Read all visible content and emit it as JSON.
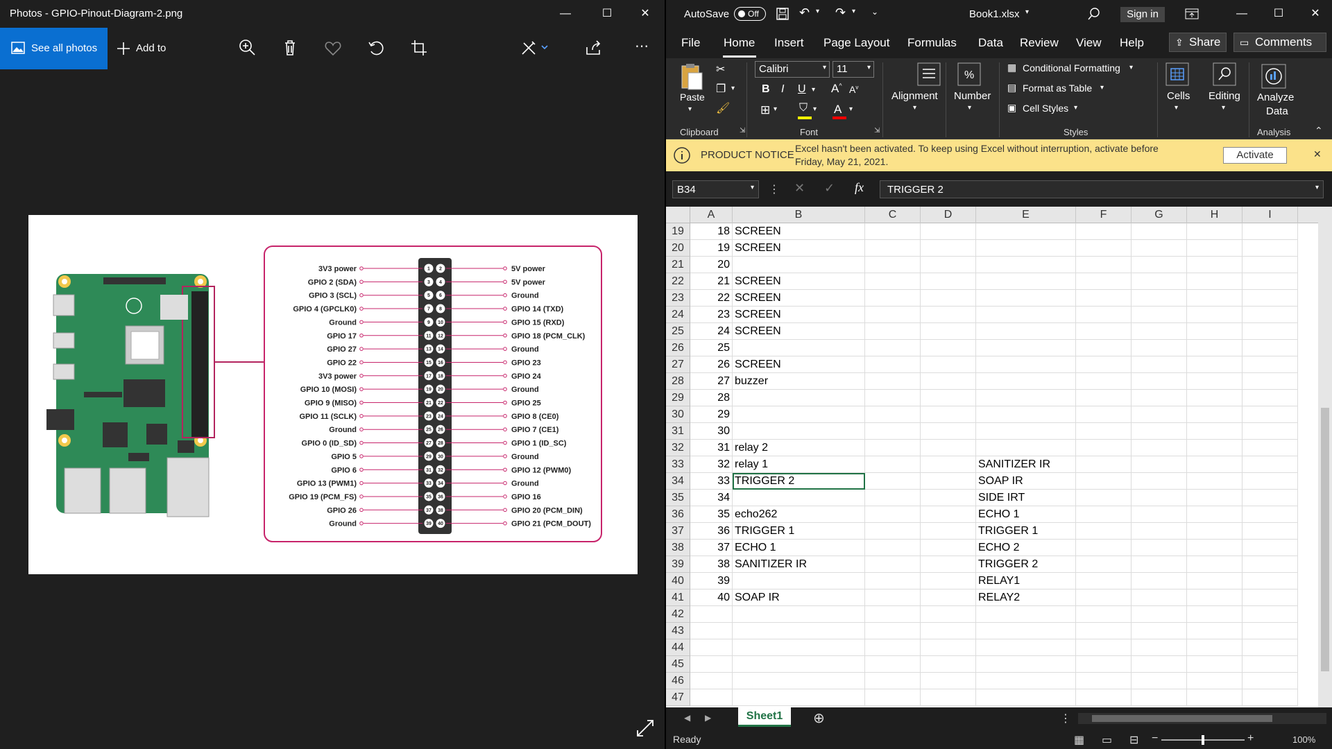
{
  "photos": {
    "title": "Photos - GPIO-Pinout-Diagram-2.png",
    "see_all": "See all photos",
    "add_to": "Add to",
    "left_pins": [
      "3V3 power",
      "GPIO 2 (SDA)",
      "GPIO 3 (SCL)",
      "GPIO 4 (GPCLK0)",
      "Ground",
      "GPIO 17",
      "GPIO 27",
      "GPIO 22",
      "3V3 power",
      "GPIO 10 (MOSI)",
      "GPIO 9 (MISO)",
      "GPIO 11 (SCLK)",
      "Ground",
      "GPIO 0 (ID_SD)",
      "GPIO 5",
      "GPIO 6",
      "GPIO 13 (PWM1)",
      "GPIO 19 (PCM_FS)",
      "GPIO 26",
      "Ground"
    ],
    "right_pins": [
      "5V power",
      "5V power",
      "Ground",
      "GPIO 14 (TXD)",
      "GPIO 15 (RXD)",
      "GPIO 18 (PCM_CLK)",
      "Ground",
      "GPIO 23",
      "GPIO 24",
      "Ground",
      "GPIO 25",
      "GPIO 8 (CE0)",
      "GPIO 7 (CE1)",
      "GPIO 1 (ID_SC)",
      "Ground",
      "GPIO 12 (PWM0)",
      "Ground",
      "GPIO 16",
      "GPIO 20 (PCM_DIN)",
      "GPIO 21 (PCM_DOUT)"
    ]
  },
  "excel": {
    "autosave": "AutoSave",
    "autosave_state": "Off",
    "filename": "Book1.xlsx",
    "signin": "Sign in",
    "tabs": [
      "File",
      "Home",
      "Insert",
      "Page Layout",
      "Formulas",
      "Data",
      "Review",
      "View",
      "Help"
    ],
    "share": "Share",
    "comments": "Comments",
    "ribbon": {
      "paste": "Paste",
      "font_name": "Calibri",
      "font_size": "11",
      "alignment": "Alignment",
      "number": "Number",
      "cond_format": "Conditional Formatting",
      "format_table": "Format as Table",
      "cell_styles": "Cell Styles",
      "cells": "Cells",
      "editing": "Editing",
      "analyze": "Analyze",
      "analyze2": "Data",
      "g_clipboard": "Clipboard",
      "g_font": "Font",
      "g_styles": "Styles",
      "g_analysis": "Analysis"
    },
    "notice": {
      "title": "PRODUCT NOTICE",
      "text1": "Excel hasn't been activated. To keep using Excel without interruption, activate before",
      "text2": "Friday, May 21, 2021.",
      "button": "Activate"
    },
    "name_box": "B34",
    "formula": "TRIGGER 2",
    "columns": [
      "A",
      "B",
      "C",
      "D",
      "E",
      "F",
      "G",
      "H",
      "I"
    ],
    "rows": [
      {
        "r": "19",
        "a": "18",
        "b": "SCREEN",
        "e": ""
      },
      {
        "r": "20",
        "a": "19",
        "b": "SCREEN",
        "e": ""
      },
      {
        "r": "21",
        "a": "20",
        "b": "",
        "e": ""
      },
      {
        "r": "22",
        "a": "21",
        "b": "SCREEN",
        "e": ""
      },
      {
        "r": "23",
        "a": "22",
        "b": "SCREEN",
        "e": ""
      },
      {
        "r": "24",
        "a": "23",
        "b": "SCREEN",
        "e": ""
      },
      {
        "r": "25",
        "a": "24",
        "b": "SCREEN",
        "e": ""
      },
      {
        "r": "26",
        "a": "25",
        "b": "",
        "e": ""
      },
      {
        "r": "27",
        "a": "26",
        "b": "SCREEN",
        "e": ""
      },
      {
        "r": "28",
        "a": "27",
        "b": "buzzer",
        "e": ""
      },
      {
        "r": "29",
        "a": "28",
        "b": "",
        "e": ""
      },
      {
        "r": "30",
        "a": "29",
        "b": "",
        "e": ""
      },
      {
        "r": "31",
        "a": "30",
        "b": "",
        "e": ""
      },
      {
        "r": "32",
        "a": "31",
        "b": "relay 2",
        "e": ""
      },
      {
        "r": "33",
        "a": "32",
        "b": "relay 1",
        "e": "SANITIZER IR"
      },
      {
        "r": "34",
        "a": "33",
        "b": "TRIGGER 2",
        "e": "SOAP IR"
      },
      {
        "r": "35",
        "a": "34",
        "b": "",
        "e": "SIDE IRT"
      },
      {
        "r": "36",
        "a": "35",
        "b": "echo262",
        "e": "ECHO 1"
      },
      {
        "r": "37",
        "a": "36",
        "b": "TRIGGER 1",
        "e": "TRIGGER 1"
      },
      {
        "r": "38",
        "a": "37",
        "b": "ECHO 1",
        "e": "ECHO 2"
      },
      {
        "r": "39",
        "a": "38",
        "b": "SANITIZER IR",
        "e": "TRIGGER 2"
      },
      {
        "r": "40",
        "a": "39",
        "b": "",
        "e": "RELAY1"
      },
      {
        "r": "41",
        "a": "40",
        "b": "SOAP IR",
        "e": "RELAY2"
      },
      {
        "r": "42",
        "a": "",
        "b": "",
        "e": ""
      },
      {
        "r": "43",
        "a": "",
        "b": "",
        "e": ""
      },
      {
        "r": "44",
        "a": "",
        "b": "",
        "e": ""
      },
      {
        "r": "45",
        "a": "",
        "b": "",
        "e": ""
      },
      {
        "r": "46",
        "a": "",
        "b": "",
        "e": ""
      },
      {
        "r": "47",
        "a": "",
        "b": "",
        "e": ""
      }
    ],
    "sheet_tab": "Sheet1",
    "status": "Ready",
    "zoom": "100%"
  }
}
